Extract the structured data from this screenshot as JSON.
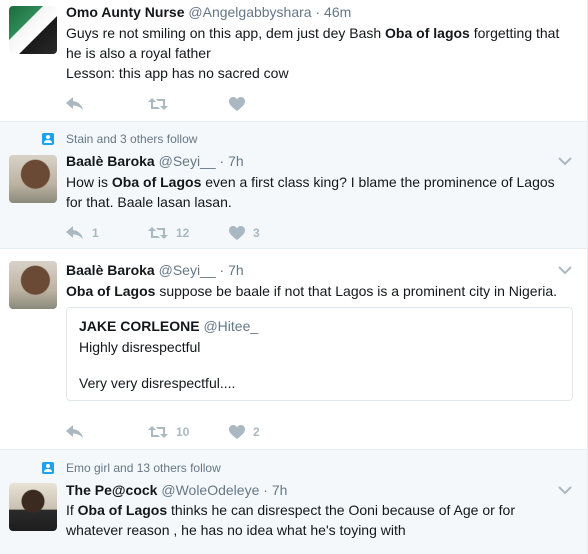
{
  "tweets": [
    {
      "name": "Omo Aunty Nurse",
      "handle": "@Angelgabbyshara",
      "dot": "·",
      "time": "46m",
      "line1_a": "Guys re not smiling on this app, dem just dey Bash ",
      "line1_b": "Oba of lagos",
      "line1_c": " forgetting that",
      "line2": "he is also a royal father",
      "line3": "Lesson: this app has no sacred cow"
    },
    {
      "social": "Stain and 3 others follow",
      "name": "Baalè Baroka",
      "handle": "@Seyi__",
      "dot": "·",
      "time": "7h",
      "line1_a": "How is ",
      "line1_b": "Oba of Lagos",
      "line1_c": " even a first class king? I blame the prominence of Lagos",
      "line2": "for that. Baale lasan lasan.",
      "reply_count": "1",
      "retweet_count": "12",
      "like_count": "3"
    },
    {
      "name": "Baalè Baroka",
      "handle": "@Seyi__",
      "dot": "·",
      "time": "7h",
      "line1_b": "Oba of Lagos",
      "line1_c": " suppose be baale if not that Lagos is a prominent city in Nigeria.",
      "quote": {
        "name": "JAKE CORLEONE",
        "handle": "@Hitee_",
        "line1": "Highly disrespectful",
        "line2": "Very very disrespectful...."
      },
      "retweet_count": "10",
      "like_count": "2"
    },
    {
      "social": "Emo girl and 13 others follow",
      "name": "The Pe@cock",
      "handle": "@WoleOdeleye",
      "dot": "·",
      "time": "7h",
      "line1_a": "If ",
      "line1_b": "Oba of Lagos",
      "line1_c": " thinks he can disrespect the Ooni because of Age or for",
      "line2": "whatever reason , he has no idea what he's toying with"
    }
  ],
  "icons": {
    "reply": "reply-icon",
    "retweet": "retweet-icon",
    "like": "heart-icon",
    "caret": "chevron-down-icon",
    "social": "person-follow-icon"
  },
  "colors": {
    "icon": "#aab8c2",
    "muted": "#657786",
    "accent": "#1da1f2",
    "text": "#14171a"
  }
}
